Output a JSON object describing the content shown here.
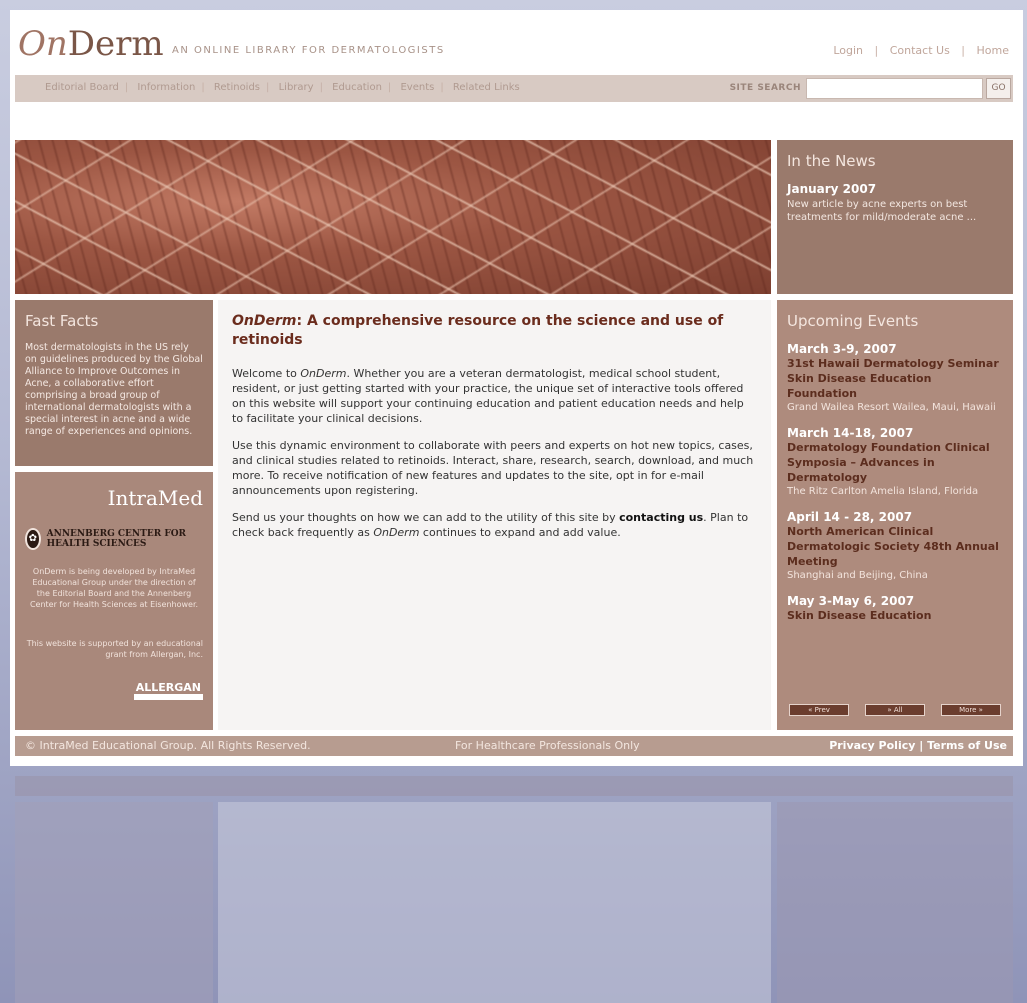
{
  "header": {
    "logo_on": "On",
    "logo_derm": "Derm",
    "tagline": "AN ONLINE LIBRARY FOR DERMATOLOGISTS",
    "links": [
      "Login",
      "Contact Us",
      "Home"
    ],
    "separator": "|"
  },
  "nav": {
    "items": [
      "Editorial Board",
      "Information",
      "Retinoids",
      "Library",
      "Education",
      "Events",
      "Related Links"
    ],
    "separator": "|",
    "site_search_label": "SITE SEARCH",
    "search_value": "",
    "go_label": "GO"
  },
  "news": {
    "title": "In the News",
    "date": "January 2007",
    "text": "New article by acne experts on best treatments for mild/moderate acne ..."
  },
  "fast_facts": {
    "title": "Fast Facts",
    "text": "Most dermatologists in the US rely on guidelines produced by the Global Alliance to Improve Outcomes in Acne, a collaborative effort comprising a broad group of international dermatologists with a special interest in acne and a wide range of experiences and opinions."
  },
  "sponsors": {
    "intramed": "IntraMed",
    "annenberg": "ANNENBERG CENTER FOR HEALTH SCIENCES",
    "text1": "OnDerm is being developed by IntraMed Educational Group under the direction of the Editorial Board and the Annenberg Center for Health Sciences at Eisenhower.",
    "text2": "This website is supported by an educational grant from Allergan, Inc.",
    "allergan": "ALLERGAN"
  },
  "main": {
    "heading_em": "OnDerm",
    "heading_rest": ": A comprehensive resource on the science and use of retinoids",
    "p1_a": "Welcome to ",
    "p1_em": "OnDerm",
    "p1_b": ". Whether you are a veteran dermatologist, medical school student, resident, or just getting started with your practice, the unique set of interactive tools offered on this website will support your continuing education and patient education needs and help to facilitate your clinical decisions.",
    "p2": "Use this dynamic environment to collaborate with peers and experts on hot new topics, cases, and clinical studies related to retinoids. Interact, share, research, search, download, and much more. To receive notification of new features and updates to the site, opt in for e-mail announcements upon registering.",
    "p3_a": "Send us your thoughts on how we can add to the utility of this site by ",
    "p3_link": "contacting us",
    "p3_b": ". Plan to check back frequently as ",
    "p3_em": "OnDerm",
    "p3_c": " continues to expand and add value."
  },
  "events": {
    "title": "Upcoming Events",
    "items": [
      {
        "date": "March 3-9, 2007",
        "title": "31st Hawaii Dermatology Seminar Skin Disease Education Foundation",
        "location": "Grand Wailea Resort Wailea, Maui, Hawaii"
      },
      {
        "date": "March 14-18, 2007",
        "title": "Dermatology Foundation Clinical Symposia – Advances in Dermatology",
        "location": "The Ritz Carlton Amelia Island, Florida"
      },
      {
        "date": "April 14 - 28, 2007",
        "title": "North American Clinical Dermatologic Society 48th Annual Meeting",
        "location": "Shanghai and Beijing, China"
      },
      {
        "date": "May 3-May 6, 2007",
        "title": "Skin Disease Education",
        "location": ""
      }
    ],
    "buttons": [
      "« Prev",
      "» All",
      "More »"
    ]
  },
  "footer": {
    "copyright": "© IntraMed Educational Group. All Rights Reserved.",
    "hcp": "For Healthcare Professionals Only",
    "privacy": "Privacy Policy",
    "terms": "Terms of Use",
    "separator": " | "
  }
}
